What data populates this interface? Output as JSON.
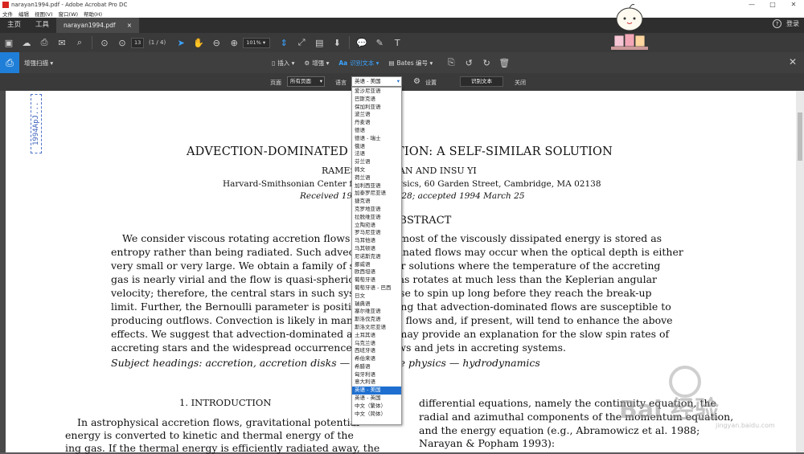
{
  "window": {
    "title": "narayan1994.pdf - Adobe Acrobat Pro DC",
    "controls": [
      "—",
      "□",
      "✕"
    ]
  },
  "menu": [
    "文件",
    "编辑",
    "视图(V)",
    "窗口(W)",
    "帮助(H)"
  ],
  "tabs": {
    "home": "主页",
    "tools": "工具",
    "doc": "narayan1994.pdf",
    "doc_close": "×",
    "help_icon": "?",
    "login": "登录"
  },
  "toolbar": {
    "page_field": "13",
    "page_count": "(1 / 4)",
    "zoom": "101%"
  },
  "scanbar": {
    "label": "增强扫描 ▾",
    "insert": "插入 ▾",
    "enhance": "增强 ▾",
    "recognize": "识别文本 ▾",
    "bates": "Bates 编号 ▾"
  },
  "options": {
    "pages_label": "页面",
    "pages_value": "所有页面",
    "lang_label": "语言",
    "lang_value": "英语 - 美国",
    "settings": "设置",
    "recognize_btn": "识别文本",
    "close": "关闭"
  },
  "language_options": [
    "爱沙尼亚语",
    "巴斯克语",
    "保加利亚语",
    "波兰语",
    "丹麦语",
    "德语",
    "德语 - 瑞士",
    "俄语",
    "法语",
    "芬兰语",
    "韩文",
    "荷兰语",
    "加利西亚语",
    "加泰罗尼亚语",
    "捷克语",
    "克罗地亚语",
    "拉脱维亚语",
    "立陶宛语",
    "罗马尼亚语",
    "马耳他语",
    "马其顿语",
    "尼诺斯克语",
    "挪威语",
    "欧西坦语",
    "葡萄牙语",
    "葡萄牙语 - 巴西",
    "日文",
    "瑞典语",
    "塞尔维亚语",
    "斯洛伐克语",
    "斯洛文尼亚语",
    "土耳其语",
    "乌克兰语",
    "西班牙语",
    "希伯来语",
    "希腊语",
    "匈牙利语",
    "意大利语",
    "英语 - 美国",
    "英语 - 英国",
    "中文（繁体）",
    "中文（简体）"
  ],
  "selected_language": "英语 - 美国",
  "document": {
    "stamp": "1994ApJ...",
    "title": "ADVECTION-DOMINATED ACCRETION: A SELF-SIMILAR SOLUTION",
    "authors": "RAMESH NARAYAN AND INSU YI",
    "affiliation": "Harvard-Smithsonian Center for Astrophysics, 60 Garden Street, Cambridge, MA 02138",
    "received": "Received 1994 January 28; accepted 1994 March 25",
    "abstract_heading": "ABSTRACT",
    "abstract_lines": [
      "We consider viscous rotating accretion flows in which most of the viscously dissipated energy is stored as",
      "entropy rather than being radiated. Such advection-dominated flows may occur when the optical depth is either",
      "very small or very large. We obtain a family of self-similar solutions where the temperature of the accreting",
      "gas is nearly virial and the flow is quasi-spherical. The gas rotates at much less than the Keplerian angular",
      "velocity; therefore, the central stars in such systems cease to spin up long before they reach the break-up",
      "limit. Further, the Bernoulli parameter is positive, implying that advection-dominated flows are susceptible to",
      "producing outflows. Convection is likely in many of these flows and, if present, will tend to enhance the above",
      "effects. We suggest that advection-dominated accretion may provide an explanation for the slow spin rates of",
      "accreting stars and the widespread occurrence of outflows and jets in accreting systems."
    ],
    "subject_headings": "Subject headings: accretion, accretion disks — black hole physics — hydrodynamics",
    "intro_heading": "1. INTRODUCTION",
    "col1_lines": [
      "In astrophysical accretion flows, gravitational potential",
      "energy is converted to kinetic and thermal energy of the",
      "ing gas. If the thermal energy is efficiently radiated away, the"
    ],
    "col2_lines": [
      "differential equations, namely the continuity equation, the",
      "radial and azimuthal components of the momentum equation,",
      "and the energy equation (e.g., Abramowicz et al. 1988;",
      "Narayan & Popham 1993):"
    ]
  },
  "watermark": {
    "text": "Bai 经验",
    "sub": "jingyan.baidu.com"
  }
}
